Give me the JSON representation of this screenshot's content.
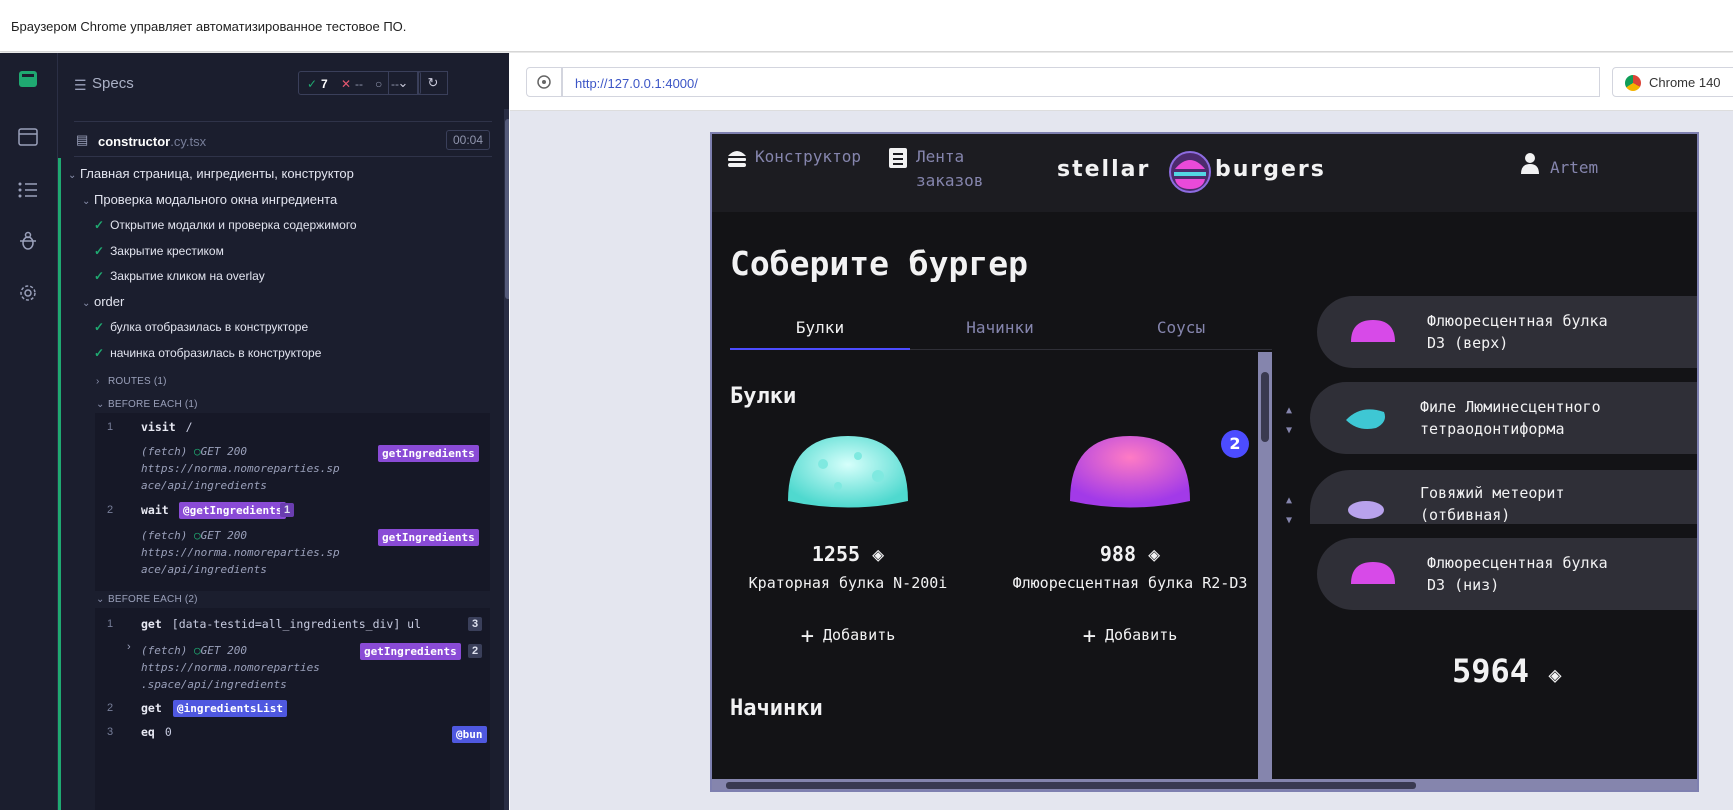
{
  "banner": {
    "text": "Браузером Chrome управляет автоматизированное тестовое ПО."
  },
  "reporter": {
    "specs_label": "Specs",
    "passed": "7",
    "failed": "--",
    "pending": "--",
    "file": {
      "name": "constructor",
      "ext": ".cy.tsx",
      "duration": "00:04"
    },
    "suite_title": "Главная страница, ингредиенты, конструктор",
    "sub_suite": "Проверка модального окна ингредиента",
    "tests_a": [
      "Открытие модалки и проверка содержимого",
      "Закрытие крестиком",
      "Закрытие кликом на overlay"
    ],
    "order": "order",
    "tests_b": [
      "булка отобразилась в конструкторе",
      "начинка отобразилась в конструкторе"
    ],
    "routes": "ROUTES (1)",
    "before_each_1": "BEFORE EACH (1)",
    "before_each_2": "BEFORE EACH (2)",
    "cmd": {
      "visit": "visit",
      "visit_arg": "/",
      "fetch": "(fetch)",
      "get200": "GET 200",
      "url1a": "https://norma.nomoreparties.sp",
      "url1b": "ace/api/ingredients",
      "url2a": "https://norma.nomoreparties",
      "url2b": ".space/api/ingredients",
      "alias_get": "getIngredients",
      "wait": "wait",
      "wait_alias": "@getIngredients",
      "wait_cnt": "1",
      "get": "get",
      "get_arg": "[data-testid=all_ingredients_div] ul",
      "get_cnt": "3",
      "fetch_cnt": "2",
      "get2_alias": "@ingredientsList",
      "eq": "eq",
      "eq_arg": "0",
      "bun_alias": "@bun",
      "n1": "1",
      "n2": "2",
      "n3": "3"
    }
  },
  "browser": {
    "url": "http://127.0.0.1:4000/",
    "name": "Chrome 140"
  },
  "app": {
    "nav": {
      "constructor": "Конструктор",
      "feed1": "Лента",
      "feed2": "заказов",
      "profile": "Artem"
    },
    "logo": {
      "left": "stellar",
      "right": "burgers"
    },
    "title": "Соберите бургер",
    "tabs": [
      "Булки",
      "Начинки",
      "Соусы"
    ],
    "section_buns": "Булки",
    "section_fillings": "Начинки",
    "ingredients": [
      {
        "price": "1255",
        "name": "Краторная булка N-200i",
        "add": "Добавить"
      },
      {
        "price": "988",
        "name": "Флюоресцентная булка R2-D3",
        "add": "Добавить",
        "count": "2"
      }
    ],
    "constructor": [
      {
        "l1": "Флюоресцентная булка",
        "l2": "D3 (верх)"
      },
      {
        "l1": "Филе Люминесцентного",
        "l2": "тетраодонтиформа"
      },
      {
        "l1": "Говяжий метеорит",
        "l2": "(отбивная)"
      },
      {
        "l1": "Флюоресцентная булка",
        "l2": "D3 (низ)"
      }
    ],
    "total": "5964"
  }
}
